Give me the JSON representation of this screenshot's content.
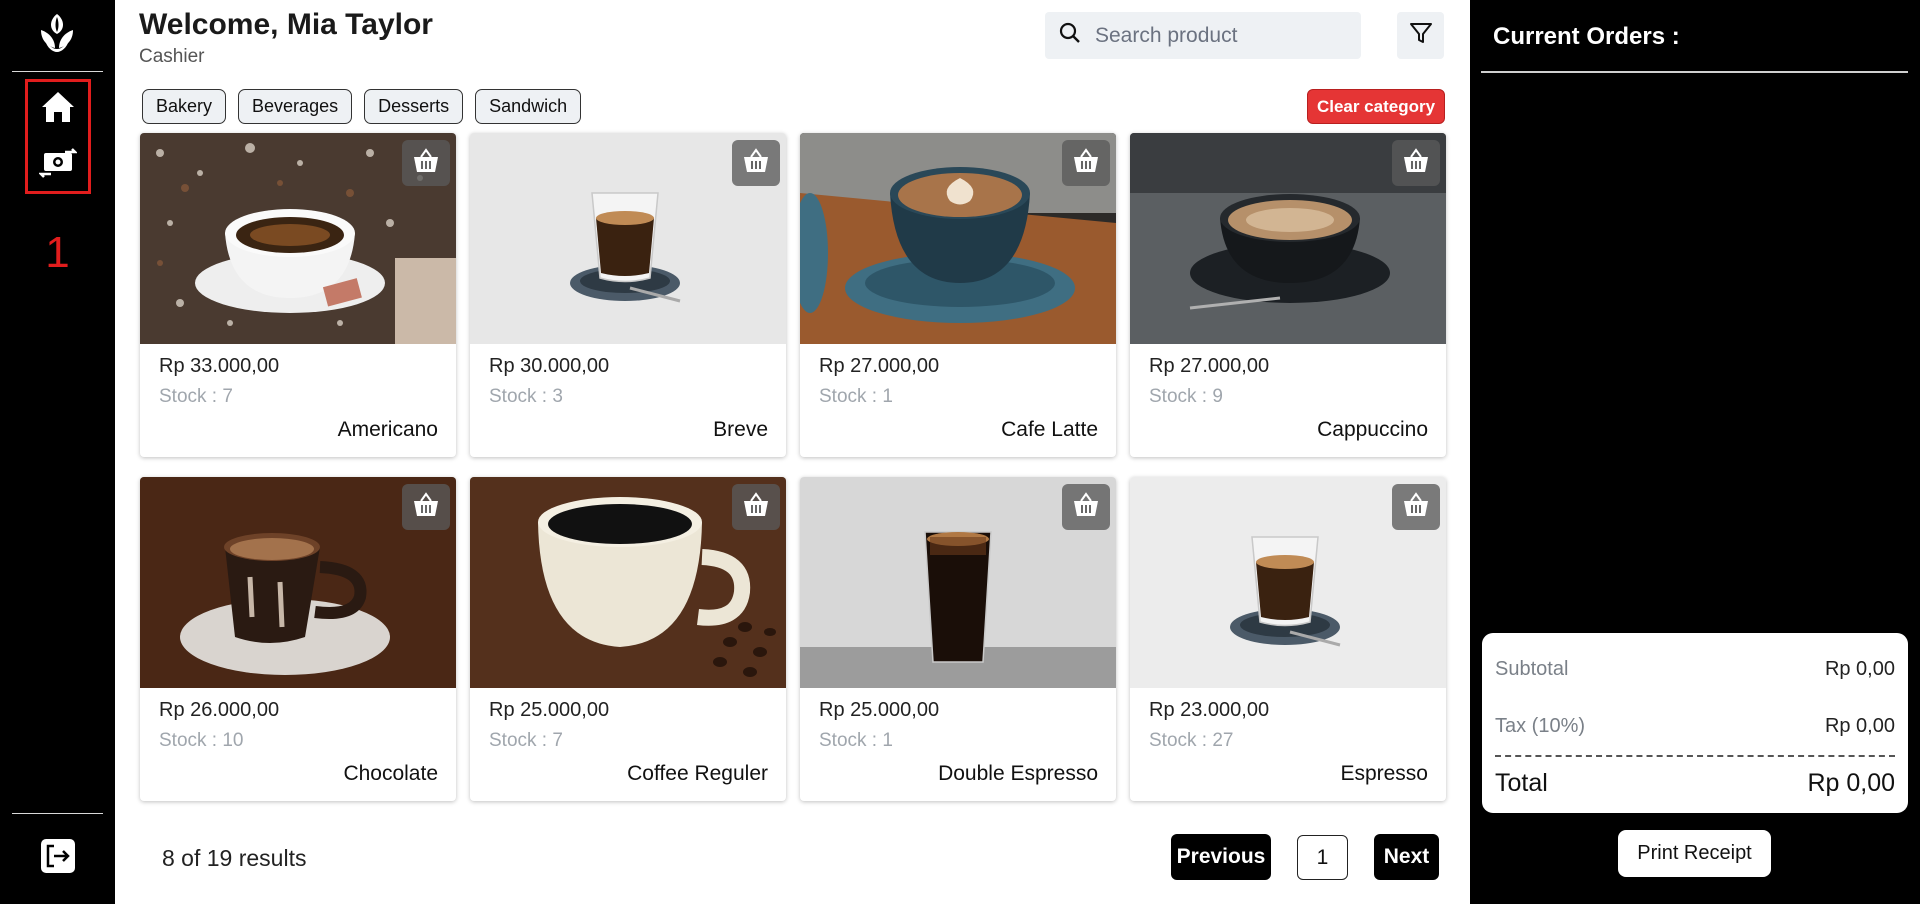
{
  "sidebar": {
    "logo_icon": "coffee-beans-logo",
    "home_icon": "home-icon",
    "transactions_icon": "money-transfer-icon",
    "highlight_label": "1",
    "highlight_color": "#e11d1d",
    "logout_icon": "logout-icon"
  },
  "header": {
    "welcome": "Welcome, Mia Taylor",
    "role": "Cashier",
    "search_placeholder": "Search product",
    "filter_icon": "filter-icon"
  },
  "categories": [
    "Bakery",
    "Beverages",
    "Desserts",
    "Sandwich"
  ],
  "clear_category_label": "Clear category",
  "products": [
    {
      "price": "Rp 33.000,00",
      "stock": "Stock : 7",
      "name": "Americano"
    },
    {
      "price": "Rp 30.000,00",
      "stock": "Stock : 3",
      "name": "Breve"
    },
    {
      "price": "Rp 27.000,00",
      "stock": "Stock : 1",
      "name": "Cafe Latte"
    },
    {
      "price": "Rp 27.000,00",
      "stock": "Stock : 9",
      "name": "Cappuccino"
    },
    {
      "price": "Rp 26.000,00",
      "stock": "Stock : 10",
      "name": "Chocolate"
    },
    {
      "price": "Rp 25.000,00",
      "stock": "Stock : 7",
      "name": "Coffee Reguler"
    },
    {
      "price": "Rp 25.000,00",
      "stock": "Stock : 1",
      "name": "Double Espresso"
    },
    {
      "price": "Rp 23.000,00",
      "stock": "Stock : 27",
      "name": "Espresso"
    }
  ],
  "pagination": {
    "results": "8 of 19 results",
    "previous": "Previous",
    "page": "1",
    "next": "Next"
  },
  "orders": {
    "title": "Current Orders :",
    "subtotal_label": "Subtotal",
    "subtotal_value": "Rp 0,00",
    "tax_label": "Tax (10%)",
    "tax_value": "Rp 0,00",
    "total_label": "Total",
    "total_value": "Rp 0,00",
    "print_label": "Print Receipt"
  },
  "colors": {
    "sidebar_bg": "#000000",
    "accent_red": "#e53535",
    "chip_bg": "#eef1f4"
  }
}
